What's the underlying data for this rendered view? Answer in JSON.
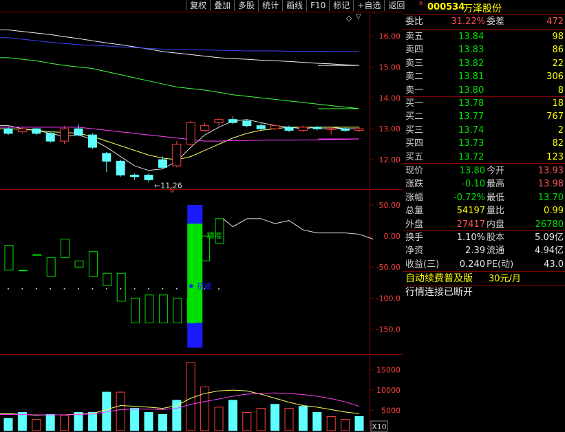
{
  "toolbar": [
    {
      "id": "fuquan",
      "label": "复权"
    },
    {
      "id": "diejia",
      "label": "叠加"
    },
    {
      "id": "duogu",
      "label": "多股"
    },
    {
      "id": "tongji",
      "label": "统计"
    },
    {
      "id": "huaxian",
      "label": "画线"
    },
    {
      "id": "f10",
      "label": "F10"
    },
    {
      "id": "biaoji",
      "label": "标记"
    },
    {
      "id": "zixuan",
      "label": "+自选"
    },
    {
      "id": "fanhui",
      "label": "返回"
    }
  ],
  "icons": {
    "diamond": "◇",
    "dropdown": "▽"
  },
  "stock": {
    "badge": "R",
    "code": "000534",
    "name": "万泽股份"
  },
  "weibi": {
    "label1": "委比",
    "value1": "31.22%",
    "label2": "委差",
    "value2": "472"
  },
  "sell": [
    {
      "label": "卖五",
      "price": "13.84",
      "vol": "98"
    },
    {
      "label": "卖四",
      "price": "13.83",
      "vol": "86"
    },
    {
      "label": "卖三",
      "price": "13.82",
      "vol": "22"
    },
    {
      "label": "卖二",
      "price": "13.81",
      "vol": "306"
    },
    {
      "label": "卖一",
      "price": "13.80",
      "vol": "8"
    }
  ],
  "buy": [
    {
      "label": "买一",
      "price": "13.78",
      "vol": "18"
    },
    {
      "label": "买二",
      "price": "13.77",
      "vol": "767"
    },
    {
      "label": "买三",
      "price": "13.74",
      "vol": "2"
    },
    {
      "label": "买四",
      "price": "13.73",
      "vol": "82"
    },
    {
      "label": "买五",
      "price": "13.72",
      "vol": "123"
    }
  ],
  "stats": [
    {
      "l1": "现价",
      "v1": "13.80",
      "c1": "green",
      "l2": "今开",
      "v2": "13.93",
      "c2": "red"
    },
    {
      "l1": "涨跌",
      "v1": "-0.10",
      "c1": "green",
      "l2": "最高",
      "v2": "13.98",
      "c2": "red"
    },
    {
      "l1": "涨幅",
      "v1": "-0.72%",
      "c1": "green",
      "l2": "最低",
      "v2": "13.70",
      "c2": "green"
    },
    {
      "l1": "总量",
      "v1": "54197",
      "c1": "yellow",
      "l2": "量比",
      "v2": "0.99",
      "c2": "yellow"
    },
    {
      "l1": "外盘",
      "v1": "27417",
      "c1": "red",
      "l2": "内盘",
      "v2": "26780",
      "c2": "green"
    }
  ],
  "stats2": [
    {
      "l1": "换手",
      "v1": "1.10%",
      "l2": "股本",
      "v2": "5.09亿"
    },
    {
      "l1": "净资",
      "v1": "2.39",
      "l2": "流通",
      "v2": "4.94亿"
    },
    {
      "l1": "收益(三)",
      "v1": "0.240",
      "l2": "PE(动)",
      "v2": "43.0"
    }
  ],
  "promo": {
    "text": "自动续费普及版",
    "price": "30元/月"
  },
  "status": {
    "text": "行情连接已断开"
  },
  "main_chart": {
    "y_ticks": [
      "16.00",
      "15.00",
      "14.00",
      "13.00",
      "12.00"
    ],
    "low_label": "11.26",
    "signal_s": "S"
  },
  "indicator": {
    "y_ticks": [
      "50.00",
      "0.00",
      "-50.00",
      "-100.0",
      "-150.0"
    ],
    "label_jingzhun": "精准",
    "label_kuandi": "抗底"
  },
  "volume": {
    "y_ticks": [
      "15000",
      "10000",
      "5000"
    ],
    "unit": "X10"
  },
  "colors": {
    "red": "#ff5050",
    "green": "#00e000",
    "cyan": "#60ffff",
    "yellow": "#ffff00",
    "frame": "#8a0000",
    "blue": "#1a1aff"
  },
  "chart_data": [
    {
      "type": "candlestick",
      "title": "",
      "ylim": [
        11.2,
        16.5
      ],
      "y_ticks": [
        16,
        15,
        14,
        13,
        12
      ],
      "candles": [
        {
          "o": 13.0,
          "c": 12.85,
          "h": 13.05,
          "l": 12.8
        },
        {
          "o": 12.9,
          "c": 13.0,
          "h": 13.05,
          "l": 12.85
        },
        {
          "o": 13.0,
          "c": 12.85,
          "h": 13.02,
          "l": 12.8
        },
        {
          "o": 12.85,
          "c": 12.6,
          "h": 12.9,
          "l": 12.55
        },
        {
          "o": 12.6,
          "c": 13.0,
          "h": 13.1,
          "l": 12.5
        },
        {
          "o": 13.0,
          "c": 12.8,
          "h": 13.15,
          "l": 12.75
        },
        {
          "o": 12.8,
          "c": 12.4,
          "h": 12.85,
          "l": 12.35
        },
        {
          "o": 12.2,
          "c": 11.95,
          "h": 12.25,
          "l": 11.6
        },
        {
          "o": 11.95,
          "c": 11.5,
          "h": 12.0,
          "l": 11.45
        },
        {
          "o": 11.5,
          "c": 11.45,
          "h": 11.55,
          "l": 11.35
        },
        {
          "o": 11.5,
          "c": 11.35,
          "h": 11.55,
          "l": 11.26
        },
        {
          "o": 12.0,
          "c": 11.75,
          "h": 12.1,
          "l": 11.7
        },
        {
          "o": 11.8,
          "c": 12.5,
          "h": 12.6,
          "l": 11.75
        },
        {
          "o": 12.5,
          "c": 13.2,
          "h": 13.25,
          "l": 12.45
        },
        {
          "o": 12.95,
          "c": 13.1,
          "h": 13.2,
          "l": 12.9
        },
        {
          "o": 13.2,
          "c": 13.3,
          "h": 13.35,
          "l": 13.1
        },
        {
          "o": 13.3,
          "c": 13.2,
          "h": 13.4,
          "l": 13.15
        },
        {
          "o": 13.25,
          "c": 13.1,
          "h": 13.3,
          "l": 13.05
        },
        {
          "o": 13.1,
          "c": 13.0,
          "h": 13.2,
          "l": 12.95
        },
        {
          "o": 13.0,
          "c": 13.1,
          "h": 13.15,
          "l": 12.95
        },
        {
          "o": 13.05,
          "c": 12.95,
          "h": 13.1,
          "l": 12.9
        },
        {
          "o": 12.95,
          "c": 13.05,
          "h": 13.1,
          "l": 12.9
        },
        {
          "o": 13.05,
          "c": 13.0,
          "h": 13.1,
          "l": 12.95
        },
        {
          "o": 13.0,
          "c": 13.0,
          "h": 13.05,
          "l": 12.8
        },
        {
          "o": 13.0,
          "c": 12.95,
          "h": 13.05,
          "l": 12.9
        },
        {
          "o": 12.95,
          "c": 13.0,
          "h": 13.05,
          "l": 12.9
        }
      ],
      "lines": [
        {
          "color": "#e0e0e0",
          "values": [
            13.1,
            13.0,
            12.95,
            12.85,
            12.75,
            12.8,
            12.65,
            12.4,
            12.1,
            11.8,
            11.65,
            11.7,
            11.95,
            12.4,
            12.8,
            13.05,
            13.25,
            13.3,
            13.2,
            13.1,
            13.05,
            13.0,
            13.05,
            13.05,
            13.0,
            13.0
          ]
        },
        {
          "color": "#ffff60",
          "values": [
            13.0,
            12.98,
            12.95,
            12.9,
            12.88,
            12.85,
            12.75,
            12.6,
            12.45,
            12.3,
            12.15,
            12.05,
            12.0,
            12.1,
            12.3,
            12.5,
            12.7,
            12.85,
            12.95,
            13.0,
            13.05,
            13.05,
            13.05,
            13.05,
            13.05,
            13.05
          ]
        },
        {
          "color": "#ff40ff",
          "values": [
            13.05,
            13.05,
            13.05,
            13.05,
            13.05,
            13.05,
            13.0,
            12.95,
            12.9,
            12.85,
            12.8,
            12.75,
            12.7,
            12.65,
            12.6,
            12.6,
            12.62,
            12.62,
            12.63,
            12.63,
            12.63,
            12.64,
            12.64,
            12.65,
            12.66,
            12.67
          ]
        },
        {
          "color": "#40ff40",
          "values": [
            15.3,
            15.25,
            15.2,
            15.12,
            15.05,
            15.0,
            14.95,
            14.85,
            14.75,
            14.65,
            14.55,
            14.45,
            14.35,
            14.3,
            14.25,
            14.18,
            14.1,
            14.05,
            14.0,
            13.95,
            13.9,
            13.85,
            13.8,
            13.75,
            13.7,
            13.65
          ]
        },
        {
          "color": "#f0f0f0",
          "values": [
            16.2,
            16.15,
            16.1,
            16.05,
            15.98,
            15.92,
            15.85,
            15.78,
            15.72,
            15.65,
            15.58,
            15.5,
            15.45,
            15.4,
            15.35,
            15.3,
            15.27,
            15.25,
            15.22,
            15.2,
            15.18,
            15.15,
            15.12,
            15.1,
            15.07,
            15.05
          ]
        },
        {
          "color": "#4040ff",
          "values": [
            15.95,
            15.9,
            15.85,
            15.8,
            15.76,
            15.72,
            15.7,
            15.68,
            15.65,
            15.63,
            15.6,
            15.58,
            15.57,
            15.56,
            15.55,
            15.54,
            15.53,
            15.52,
            15.52,
            15.52,
            15.51,
            15.51,
            15.51,
            15.5,
            15.5,
            15.5
          ]
        }
      ]
    },
    {
      "type": "candlestick",
      "title": "",
      "ylim": [
        -185,
        70
      ],
      "y_ticks": [
        50,
        0,
        -50,
        -100,
        -150
      ],
      "candles": [
        {
          "o": -55,
          "c": -15
        },
        {
          "o": -55,
          "c": -55
        },
        {
          "o": -30,
          "c": -30
        },
        {
          "o": -65,
          "c": -35
        },
        {
          "o": -35,
          "c": -5
        },
        {
          "o": -40,
          "c": -50
        },
        {
          "o": -25,
          "c": -65
        },
        {
          "o": -80,
          "c": -60
        },
        {
          "o": -105,
          "c": -60
        },
        {
          "o": -140,
          "c": -100
        },
        {
          "o": -140,
          "c": -95
        },
        {
          "o": -140,
          "c": -95
        },
        {
          "o": -140,
          "c": -100
        },
        {
          "o": -140,
          "c": -100
        },
        {
          "o": -40,
          "c": 0
        },
        {
          "o": -12,
          "c": 28
        }
      ],
      "bar": {
        "index": 13,
        "blue_top": 50,
        "green_top": 20,
        "green_bottom": -140,
        "blue_bottom": -180
      },
      "line_values": [
        null,
        null,
        null,
        null,
        null,
        null,
        null,
        null,
        null,
        null,
        null,
        null,
        null,
        null,
        null,
        null,
        15,
        28,
        28,
        20,
        25,
        10,
        5,
        5,
        5,
        3,
        -5
      ],
      "dots_y": -85
    },
    {
      "type": "bar",
      "title": "",
      "ylim": [
        0,
        18000
      ],
      "y_ticks": [
        15000,
        10000,
        5000
      ],
      "bars": [
        {
          "v": 3000,
          "up": false
        },
        {
          "v": 4500,
          "up": false
        },
        {
          "v": 2800,
          "up": true
        },
        {
          "v": 4000,
          "up": false
        },
        {
          "v": 3800,
          "up": true
        },
        {
          "v": 4500,
          "up": false
        },
        {
          "v": 4500,
          "up": false
        },
        {
          "v": 9500,
          "up": false
        },
        {
          "v": 9500,
          "up": true
        },
        {
          "v": 5500,
          "up": false
        },
        {
          "v": 4500,
          "up": false
        },
        {
          "v": 4000,
          "up": false
        },
        {
          "v": 7500,
          "up": false
        },
        {
          "v": 16800,
          "up": true
        },
        {
          "v": 10800,
          "up": true
        },
        {
          "v": 5800,
          "up": true
        },
        {
          "v": 7500,
          "up": false
        },
        {
          "v": 4500,
          "up": true
        },
        {
          "v": 5500,
          "up": true
        },
        {
          "v": 6500,
          "up": false
        },
        {
          "v": 5500,
          "up": true
        },
        {
          "v": 6000,
          "up": false
        },
        {
          "v": 4500,
          "up": false
        },
        {
          "v": 3500,
          "up": true
        },
        {
          "v": 2800,
          "up": true
        },
        {
          "v": 3500,
          "up": false
        }
      ],
      "lines": [
        {
          "color": "#ffff60",
          "values": [
            4200,
            4000,
            3800,
            3900,
            3900,
            4100,
            4200,
            5200,
            6200,
            6000,
            5800,
            5500,
            6200,
            8000,
            9200,
            9800,
            10000,
            9800,
            9000,
            8000,
            7000,
            6200,
            5800,
            5200,
            4600,
            4200
          ]
        },
        {
          "color": "#ff40ff",
          "values": [
            4000,
            4000,
            3900,
            3900,
            3900,
            4000,
            4100,
            4600,
            5200,
            5300,
            5300,
            5200,
            5500,
            6500,
            7200,
            7800,
            8500,
            9000,
            9200,
            9300,
            9200,
            8900,
            8500,
            7900,
            7100,
            6000
          ]
        }
      ]
    }
  ]
}
